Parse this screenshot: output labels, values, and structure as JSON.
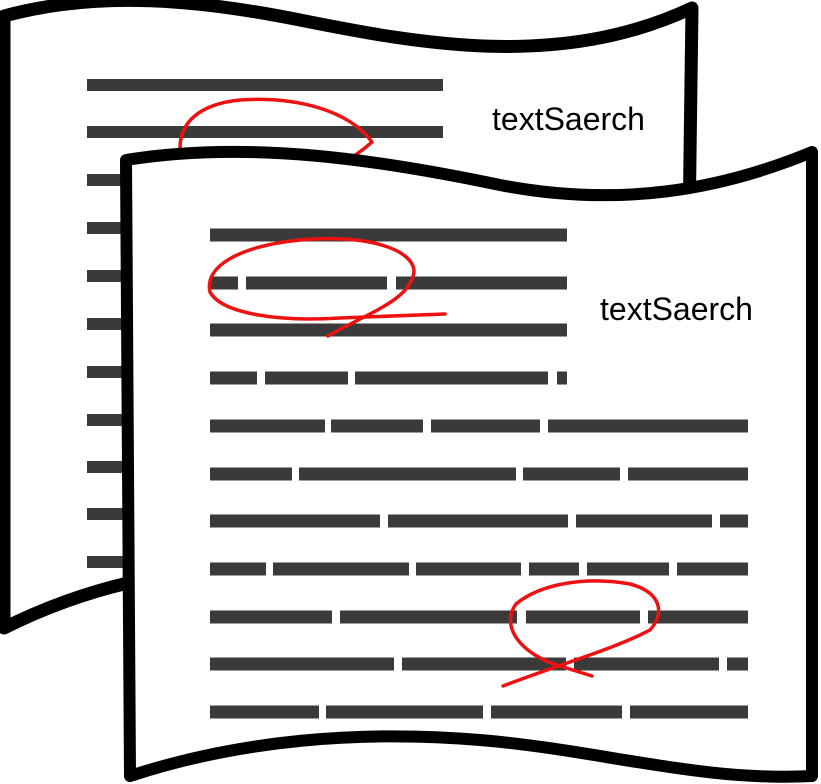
{
  "back_page": {
    "label": "textSaerch"
  },
  "front_page": {
    "label": "textSaerch"
  },
  "colors": {
    "page_outline": "#000000",
    "page_fill": "#ffffff",
    "text_line": "#3a3a3a",
    "annotation": "#ee1111"
  }
}
